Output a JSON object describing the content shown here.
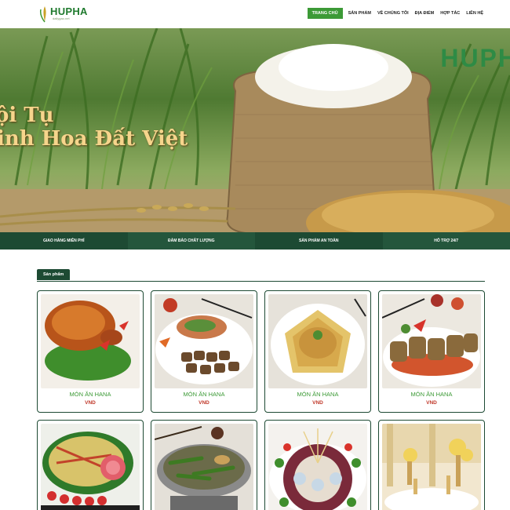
{
  "brand": {
    "logo_text": "HUPHA",
    "logo_sub": "dailygao.net",
    "hero_text": "HUPH"
  },
  "nav": {
    "items": [
      {
        "label": "Trang chủ",
        "active": true
      },
      {
        "label": "Sản phẩm",
        "active": false
      },
      {
        "label": "Về chúng tôi",
        "active": false
      },
      {
        "label": "Địa điểm",
        "active": false
      },
      {
        "label": "Hợp tác",
        "active": false
      },
      {
        "label": "Liên hệ",
        "active": false
      }
    ]
  },
  "hero": {
    "line1": "ội Tụ",
    "line2": "inh Hoa Đất Việt"
  },
  "features": [
    "Giao hàng miễn phí",
    "Đảm bảo chất lượng",
    "Sản phẩm an toàn",
    "Hỗ trợ 24/7"
  ],
  "section": {
    "title": "Sản phẩm"
  },
  "products": [
    {
      "name": "Món ăn Hana",
      "price": "VND"
    },
    {
      "name": "Món ăn Hana",
      "price": "VND"
    },
    {
      "name": "Món ăn Hana",
      "price": "VND"
    },
    {
      "name": "Món ăn Hana",
      "price": "VND"
    }
  ],
  "colors": {
    "brand_green": "#3c9a36",
    "dark_green": "#1d4a33",
    "price_red": "#c0392b",
    "hero_gold": "#f6d58c"
  }
}
